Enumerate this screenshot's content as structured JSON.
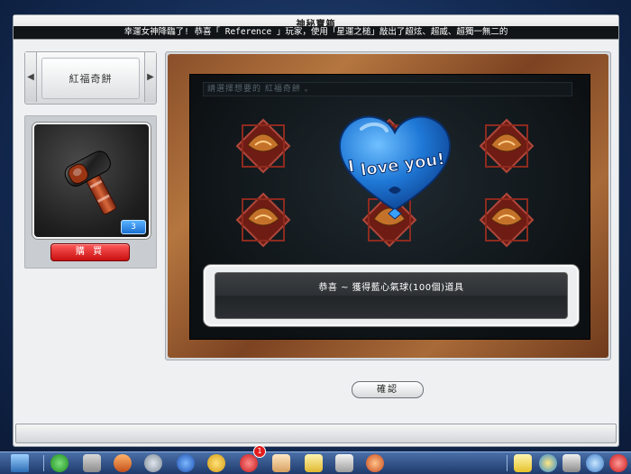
{
  "window": {
    "title": "神秘寶箱",
    "ticker": "幸運女神降臨了! 恭喜「 Reference 」玩家，使用「星運之槌」敲出了超炫、超威、超獨一無二的"
  },
  "selector": {
    "label": "紅福奇餅",
    "left_arrow": "◀",
    "right_arrow": "▶"
  },
  "item": {
    "icon": "hammer-icon",
    "quantity": "3",
    "buy_label": "購 買"
  },
  "game": {
    "prompt": "請選擇想要的 紅福奇餅 。",
    "slot_icon": "fortune-cookie-icon",
    "balloon_text": [
      "I",
      "love you!"
    ],
    "result_text": "恭喜 ~ 獲得藍心氣球(100個)道具",
    "confirm_label": "確認"
  },
  "colors": {
    "wood_frame": "#8a4f2a",
    "buy_button": "#d91a1a",
    "balloon": "#1e7ad8",
    "quantity_badge": "#2d8be6"
  },
  "taskbar": {
    "notification_count": "1",
    "icons": [
      "start-icon",
      "back-icon",
      "cart-icon",
      "character-icon",
      "settings-gear-icon",
      "potion-icon",
      "skill-icon",
      "heart-icon",
      "scroll-icon",
      "item-icon",
      "book-icon",
      "cake-icon",
      "note-icon",
      "pet-icon",
      "tools-icon",
      "search-icon",
      "power-icon"
    ]
  }
}
